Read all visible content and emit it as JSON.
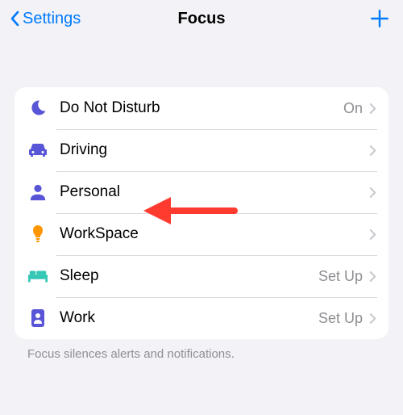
{
  "nav": {
    "back_label": "Settings",
    "title": "Focus"
  },
  "list": {
    "items": [
      {
        "label": "Do Not Disturb",
        "status": "On",
        "icon": "moon",
        "color": "#5856d6"
      },
      {
        "label": "Driving",
        "status": "",
        "icon": "car",
        "color": "#5856d6"
      },
      {
        "label": "Personal",
        "status": "",
        "icon": "person",
        "color": "#5856d6"
      },
      {
        "label": "WorkSpace",
        "status": "",
        "icon": "bulb",
        "color": "#ff9500"
      },
      {
        "label": "Sleep",
        "status": "Set Up",
        "icon": "bed",
        "color": "#34c7b5"
      },
      {
        "label": "Work",
        "status": "Set Up",
        "icon": "badge",
        "color": "#5856d6"
      }
    ]
  },
  "footer": "Focus silences alerts and notifications.",
  "colors": {
    "accent": "#007aff",
    "arrow": "#ff3b30",
    "secondary": "#8e8e93",
    "chevron": "#c7c7cc",
    "card_bg": "#ffffff",
    "page_bg": "#f2f2f7"
  }
}
